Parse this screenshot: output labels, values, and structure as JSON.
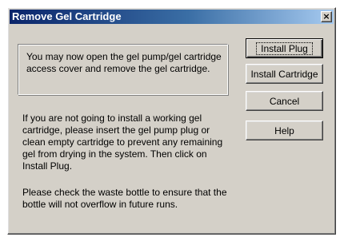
{
  "window": {
    "title": "Remove Gel Cartridge",
    "close_glyph": "×",
    "close_icon": "close-icon"
  },
  "info": {
    "text": "You may now open the gel pump/gel cartridge access cover and remove the gel cartridge."
  },
  "body": {
    "paragraph1": "If you are not going to install a working gel cartridge, please insert the gel pump plug or clean empty cartridge to prevent any remaining gel from drying in the system. Then click on Install Plug.",
    "paragraph2": "Please check the waste bottle to ensure that the bottle will not overflow in future runs."
  },
  "buttons": {
    "install_plug": "Install Plug",
    "install_cartridge": "Install Cartridge",
    "cancel": "Cancel",
    "help": "Help"
  },
  "colors": {
    "titlebar_start": "#0a246a",
    "titlebar_end": "#a6caf0",
    "window_face": "#d4d0c8"
  }
}
